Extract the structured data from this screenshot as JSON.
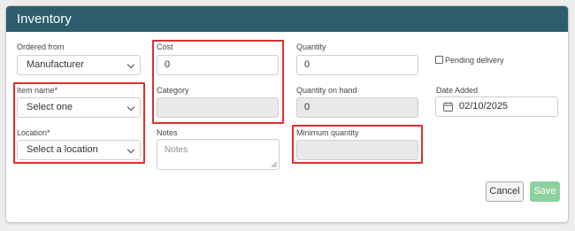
{
  "header": {
    "title": "Inventory"
  },
  "form": {
    "ordered_from": {
      "label": "Ordered from",
      "value": "Manufacturer"
    },
    "item_name": {
      "label": "Item name*",
      "value": "Select one"
    },
    "location": {
      "label": "Location*",
      "value": "Select a location"
    },
    "cost": {
      "label": "Cost",
      "value": "0"
    },
    "category": {
      "label": "Category",
      "value": ""
    },
    "notes": {
      "label": "Notes",
      "placeholder": "Notes"
    },
    "quantity": {
      "label": "Quantity",
      "value": "0"
    },
    "quantity_on_hand": {
      "label": "Quantity on hand",
      "value": "0"
    },
    "minimum_quantity": {
      "label": "Minimum quantity",
      "value": ""
    },
    "pending_delivery": {
      "label": "Pending delivery",
      "checked": false
    },
    "date_added": {
      "label": "Date Added",
      "value": "02/10/2025"
    }
  },
  "buttons": {
    "cancel": "Cancel",
    "save": "Save"
  },
  "colors": {
    "header": "#2e5d6d",
    "highlight": "#d9312b",
    "save": "#8fd19e"
  }
}
